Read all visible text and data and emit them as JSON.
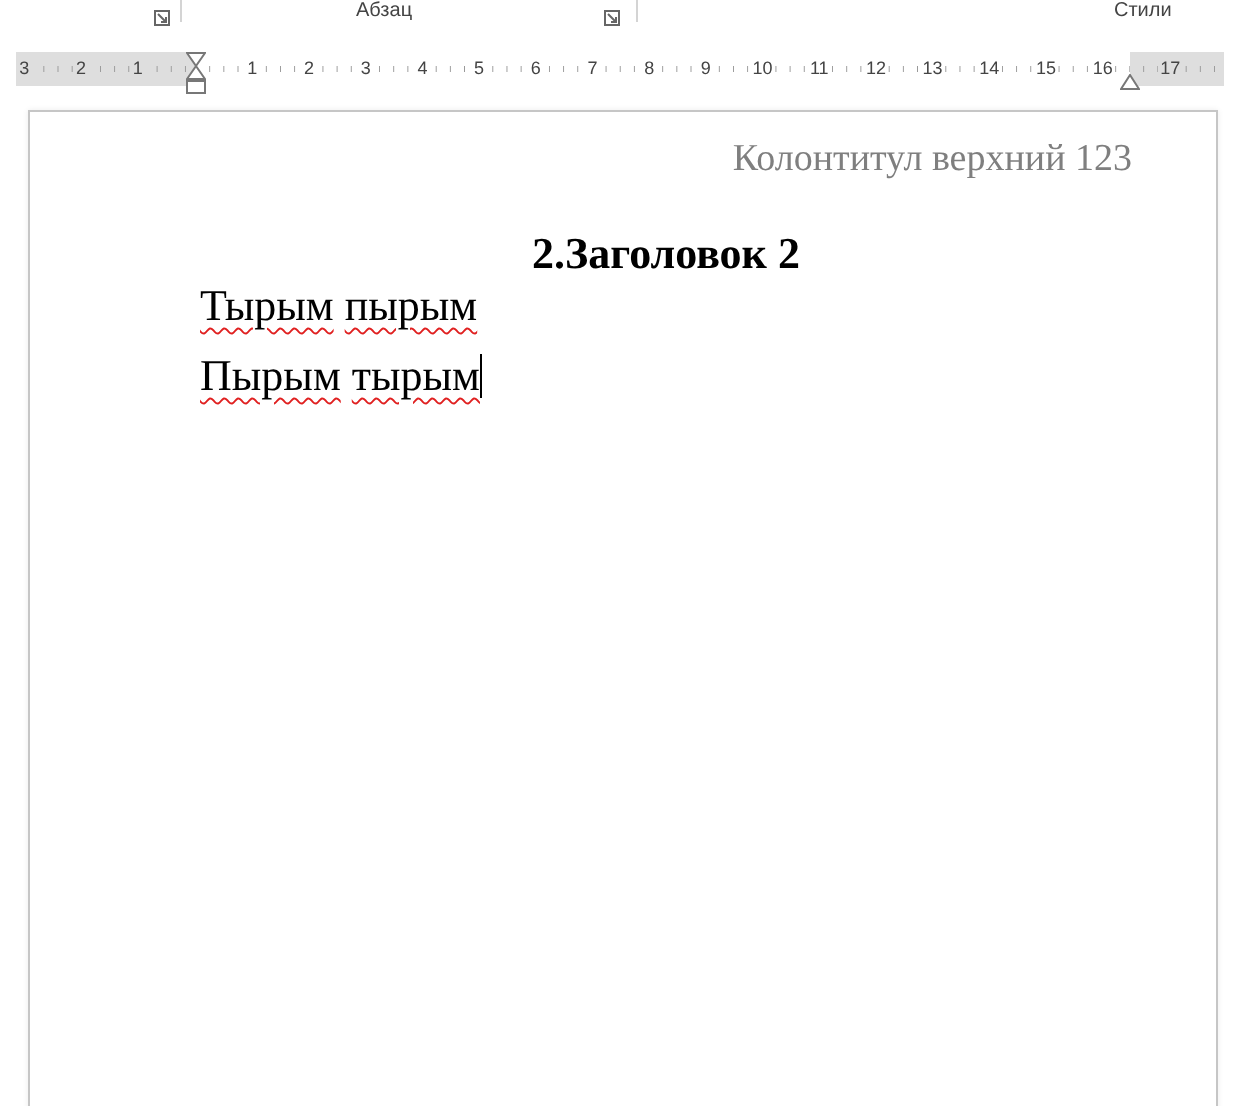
{
  "ribbon": {
    "groups": [
      {
        "label": "Абзац"
      },
      {
        "label": "Стили"
      }
    ]
  },
  "ruler": {
    "left_margin_numbers": [
      "3",
      "2",
      "1"
    ],
    "body_numbers": [
      "1",
      "2",
      "3",
      "4",
      "5",
      "6",
      "7",
      "8",
      "9",
      "10",
      "11",
      "12",
      "13",
      "14",
      "15",
      "16"
    ],
    "right_margin_numbers": [
      "17"
    ]
  },
  "page": {
    "header": "Колонтитул верхний 123",
    "heading": "2.Заголовок 2",
    "paragraphs": [
      {
        "words": [
          {
            "text": "Тырым",
            "misspelled": true
          },
          {
            "text": "пырым",
            "misspelled": true
          }
        ],
        "cursor": false
      },
      {
        "words": [
          {
            "text": "Пырым",
            "misspelled": true
          },
          {
            "text": "тырым",
            "misspelled": true
          }
        ],
        "cursor": true
      }
    ]
  }
}
